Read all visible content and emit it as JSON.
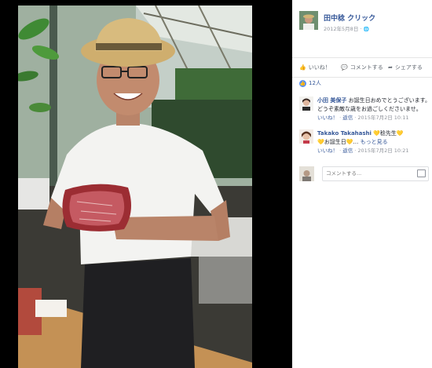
{
  "post": {
    "author": "田中稔 クリック",
    "date": "2012年5月8日 ·",
    "audience_icon": "globe-icon"
  },
  "actions": {
    "like": "いいね！",
    "comment": "コメントする",
    "share": "シェアする"
  },
  "likes": {
    "count": "12人",
    "icon": "thumbs-up-icon"
  },
  "comments": [
    {
      "author": "小田 美保子",
      "text_line1": " お誕生日おめでとうございます。",
      "text_line2": "どうぞ素敵な歳をお過ごしくださいませ。",
      "like_link": "いいね！",
      "reply_link": "返信",
      "timestamp": "2015年7月2日 10:11"
    },
    {
      "author": "Takako Takahashi",
      "text_line1": " 💛稔先生💛",
      "text_line2": "💛お誕生日💛…",
      "more_link": "もっと見る",
      "like_link": "いいね！",
      "reply_link": "返信",
      "timestamp": "2015年7月2日 10:21"
    }
  ],
  "composer": {
    "placeholder": "コメントする..."
  },
  "colors": {
    "link": "#365899",
    "meta": "#90949c",
    "like_bubble": "#5890ff"
  }
}
